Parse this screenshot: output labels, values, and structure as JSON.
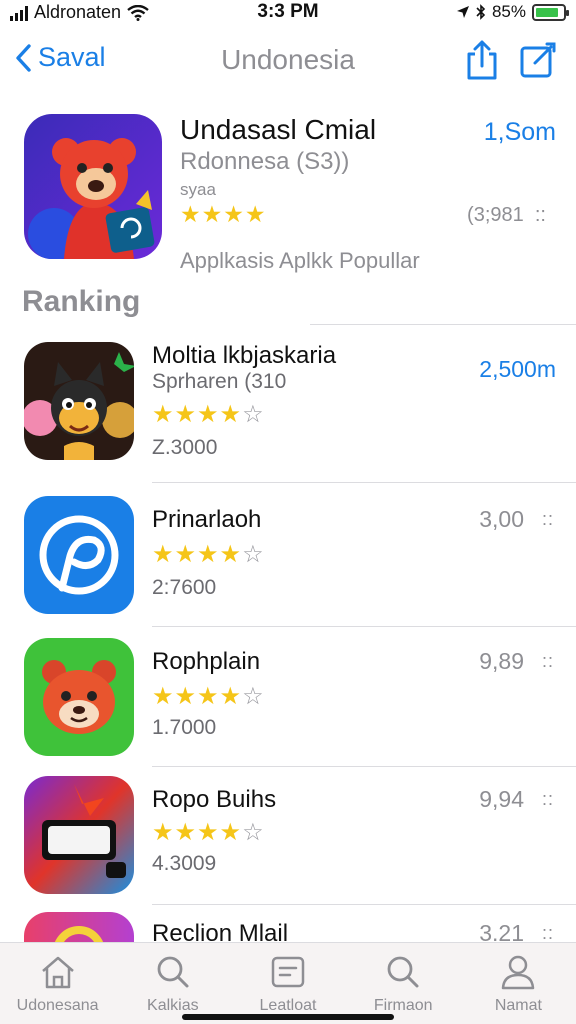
{
  "status_bar": {
    "carrier": "Aldronaten",
    "time": "3:3 PM",
    "battery": "85%",
    "battery_level": 0.85
  },
  "nav": {
    "back_label": "Saval",
    "title": "Undonesia",
    "icons": [
      "share-icon",
      "edit-icon"
    ]
  },
  "featured": {
    "name": "Undasasl Cmial",
    "subtitle": "Rdonnesa (S3))",
    "small_label": "syaa",
    "rating": 4,
    "rating_count": "(3;981",
    "price": "1,Som",
    "tagline": "Applkasis Aplkk Popullar"
  },
  "section_title": "Ranking",
  "apps": [
    {
      "name": "Moltia lkbjaskaria",
      "subtitle": "Sprharen (310",
      "rating": 4,
      "count": "Z.3000",
      "price": "2,500m",
      "price_accent": true,
      "icon": "party-animals-icon"
    },
    {
      "name": "Prinarlaoh",
      "subtitle": "",
      "rating": 4,
      "count": "2:7600",
      "price": "3,00",
      "price_accent": false,
      "icon": "pinwheel-icon"
    },
    {
      "name": "Rophplain",
      "subtitle": "",
      "rating": 4,
      "count": "1.7000",
      "price": "9,89",
      "price_accent": false,
      "icon": "bear-icon"
    },
    {
      "name": "Ropo Buihs",
      "subtitle": "",
      "rating": 4,
      "count": "4.3009",
      "price": "9,94",
      "price_accent": false,
      "icon": "logo-game-icon"
    },
    {
      "name": "Reclion Mlail",
      "subtitle": "",
      "rating": 0,
      "count": "",
      "price": "3.21",
      "price_accent": false,
      "icon": "camera-icon"
    }
  ],
  "more_symbol": "::",
  "tabs": [
    {
      "label": "Udonesana",
      "icon": "home-icon"
    },
    {
      "label": "Kalkias",
      "icon": "search-icon"
    },
    {
      "label": "Leatloat",
      "icon": "list-icon"
    },
    {
      "label": "Firmaon",
      "icon": "search-icon"
    },
    {
      "label": "Namat",
      "icon": "person-icon"
    }
  ],
  "colors": {
    "accent": "#1a7fe6",
    "star": "#f5c518",
    "secondary_text": "#8e8e93",
    "battery": "#38c24a"
  }
}
